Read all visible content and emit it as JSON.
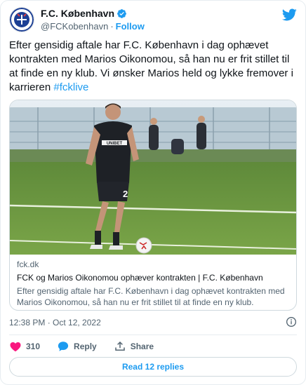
{
  "author": {
    "display_name": "F.C. København",
    "handle": "@FCKobenhavn",
    "separator": "·",
    "follow_label": "Follow"
  },
  "tweet": {
    "text": "Efter gensidig aftale har F.C. København i dag ophævet kontrakten med Marios Oikonomou, så han nu er frit stillet til at finde en ny klub. Vi ønsker Marios held og lykke fremover i karrieren",
    "hashtag": "#fcklive"
  },
  "link_card": {
    "domain": "fck.dk",
    "title": "FCK og Marios Oikonomou ophæver kontrakten | F.C. København",
    "description": "Efter gensidig aftale har F.C. København i dag ophævet kontrakten med Marios Oikonomou, så han nu er frit stillet til at finde en ny klub.",
    "image_sponsor": "UNIBET",
    "image_number": "2"
  },
  "meta": {
    "timestamp": "12:38 PM · Oct 12, 2022"
  },
  "actions": {
    "like_count": "310",
    "reply_label": "Reply",
    "share_label": "Share"
  },
  "read_replies_label": "Read 12 replies",
  "colors": {
    "accent": "#1d9bf0",
    "like": "#f91880",
    "text": "#0f1419",
    "secondary": "#536471"
  }
}
